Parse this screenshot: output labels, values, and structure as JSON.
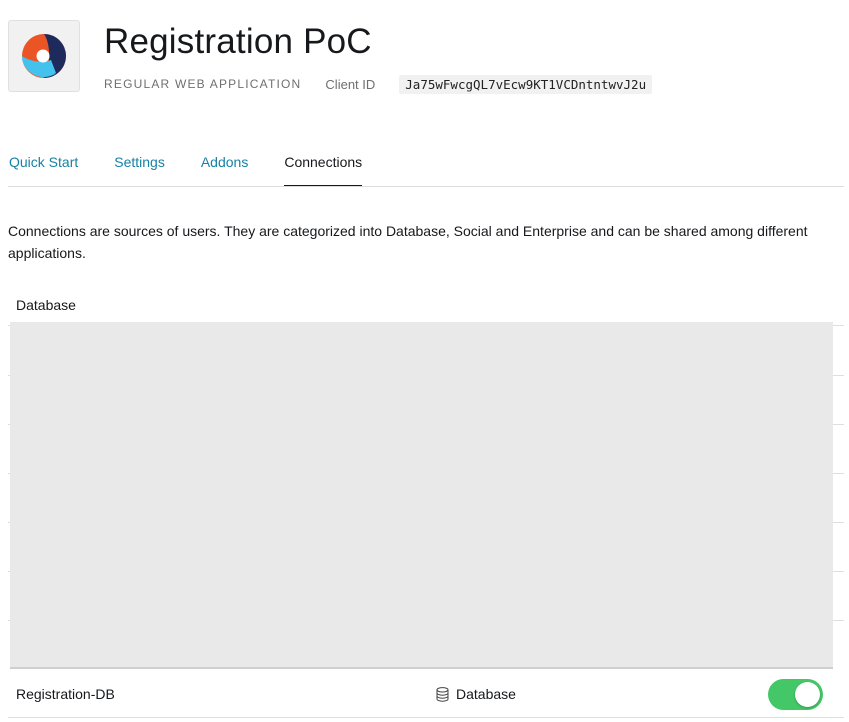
{
  "app": {
    "name": "Registration PoC",
    "type": "REGULAR WEB APPLICATION",
    "client_id_label": "Client ID",
    "client_id": "Ja75wFwcgQL7vEcw9KT1VCDntntwvJ2u"
  },
  "tabs": [
    {
      "label": "Quick Start",
      "active": false
    },
    {
      "label": "Settings",
      "active": false
    },
    {
      "label": "Addons",
      "active": false
    },
    {
      "label": "Connections",
      "active": true
    }
  ],
  "description": "Connections are sources of users. They are categorized into Database, Social and Enterprise and can be shared among different applications.",
  "database_section": {
    "label": "Database",
    "connections": [
      {
        "name": "Registration-DB",
        "type": "Database",
        "type_icon": "database-icon",
        "enabled": true
      }
    ]
  },
  "colors": {
    "link": "#1682a5",
    "toggle_on": "#44c767",
    "logo_orange": "#eb5424",
    "logo_navy": "#1f2a5c",
    "logo_sky": "#44c2ee"
  }
}
